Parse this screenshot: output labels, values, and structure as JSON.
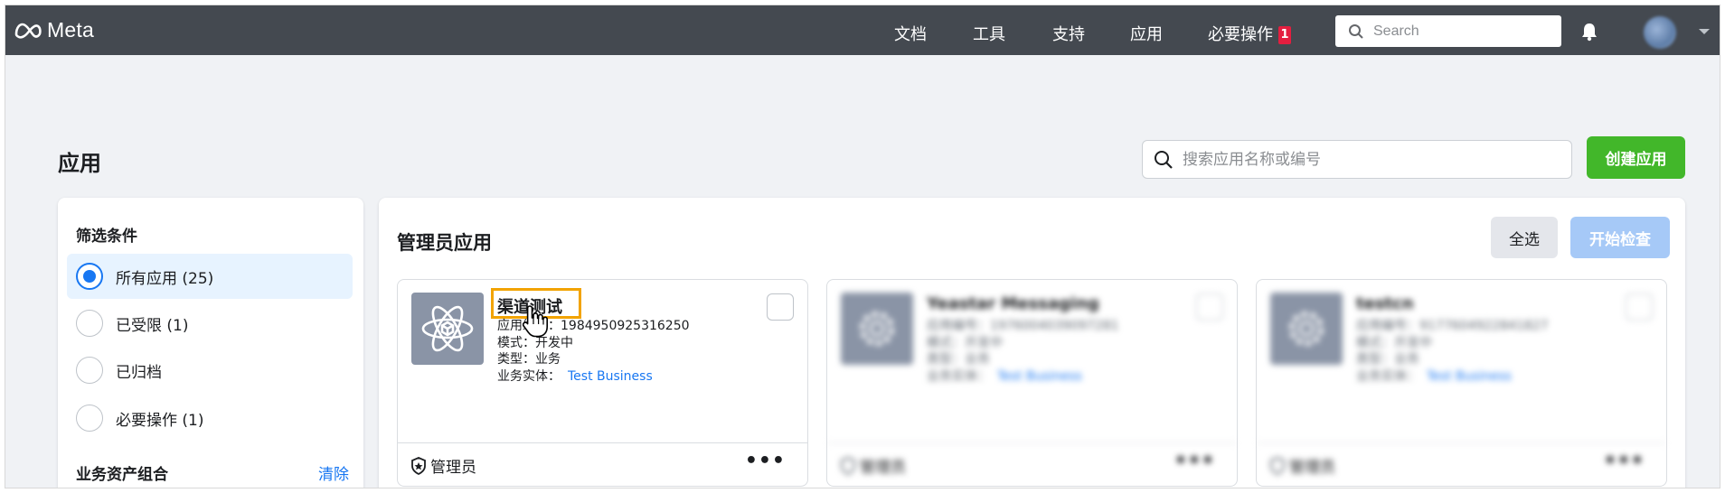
{
  "topbar": {
    "brand": "Meta",
    "nav": [
      "文档",
      "工具",
      "支持",
      "应用",
      "必要操作"
    ],
    "required_badge": "1",
    "search_placeholder": "Search"
  },
  "page": {
    "title": "应用",
    "search_placeholder": "搜索应用名称或编号",
    "create_button": "创建应用"
  },
  "filters": {
    "title": "筛选条件",
    "options": [
      {
        "label": "所有应用 (25)",
        "selected": true
      },
      {
        "label": "已受限 (1)",
        "selected": false
      },
      {
        "label": "已归档",
        "selected": false
      },
      {
        "label": "必要操作 (1)",
        "selected": false
      }
    ],
    "group_title": "业务资产组合",
    "clear_label": "清除"
  },
  "main": {
    "section_title": "管理员应用",
    "select_all": "全选",
    "start_check": "开始检查",
    "apps": [
      {
        "name": "渠道测试",
        "app_id": "应用编号：1984950925316250",
        "mode": "模式：开发中",
        "type": "类型：业务",
        "business_label": "业务实体：",
        "business": "Test Business",
        "role": "管理员",
        "blurred": false
      },
      {
        "name": "Yeastar Messaging",
        "app_id": "应用编号：1976004039097281",
        "mode": "模式：开发中",
        "type": "类型：业务",
        "business_label": "业务实体：",
        "business": "Test Business",
        "role": "管理员",
        "blurred": true
      },
      {
        "name": "testcn",
        "app_id": "应用编号：9177604922841827",
        "mode": "模式：开发中",
        "type": "类型：业务",
        "business_label": "业务实体：",
        "business": "Test Business",
        "role": "管理员",
        "blurred": true
      }
    ]
  },
  "colors": {
    "topbar": "#444950",
    "accent_blue": "#1877f2",
    "create_green": "#42b72a",
    "highlight": "#f2a300",
    "badge_red": "#e41e3f"
  }
}
